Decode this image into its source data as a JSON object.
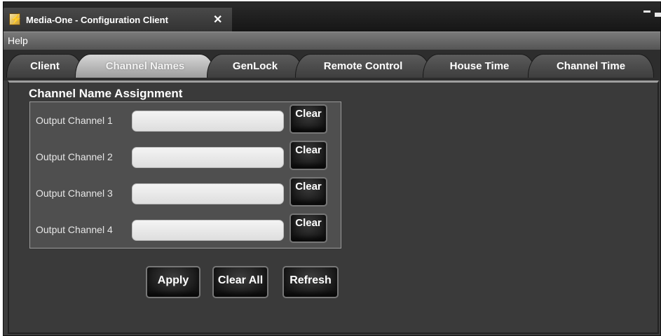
{
  "window": {
    "title": "Media-One - Configuration Client",
    "close_glyph": "✕",
    "app_icon": "lightning-icon",
    "app_icon_glyph": "⚡"
  },
  "menu": {
    "items": [
      {
        "label": "Help"
      }
    ]
  },
  "tabs": [
    {
      "label": "Client",
      "active": false
    },
    {
      "label": "Channel Names",
      "active": true
    },
    {
      "label": "GenLock",
      "active": false
    },
    {
      "label": "Remote Control",
      "active": false
    },
    {
      "label": "House Time",
      "active": false
    },
    {
      "label": "Channel Time",
      "active": false
    }
  ],
  "section": {
    "title": "Channel Name Assignment",
    "rows": [
      {
        "label": "Output Channel 1",
        "value": "",
        "clear_label": "Clear"
      },
      {
        "label": "Output Channel 2",
        "value": "",
        "clear_label": "Clear"
      },
      {
        "label": "Output Channel 3",
        "value": "",
        "clear_label": "Clear"
      },
      {
        "label": "Output Channel 4",
        "value": "",
        "clear_label": "Clear"
      }
    ]
  },
  "actions": {
    "apply_label": "Apply",
    "clear_all_label": "Clear All",
    "refresh_label": "Refresh"
  },
  "colors": {
    "panel_bg": "#3c3c3c",
    "group_bg": "#4f4f4f",
    "active_tab": "#bdbdbd",
    "text": "#ffffff"
  }
}
